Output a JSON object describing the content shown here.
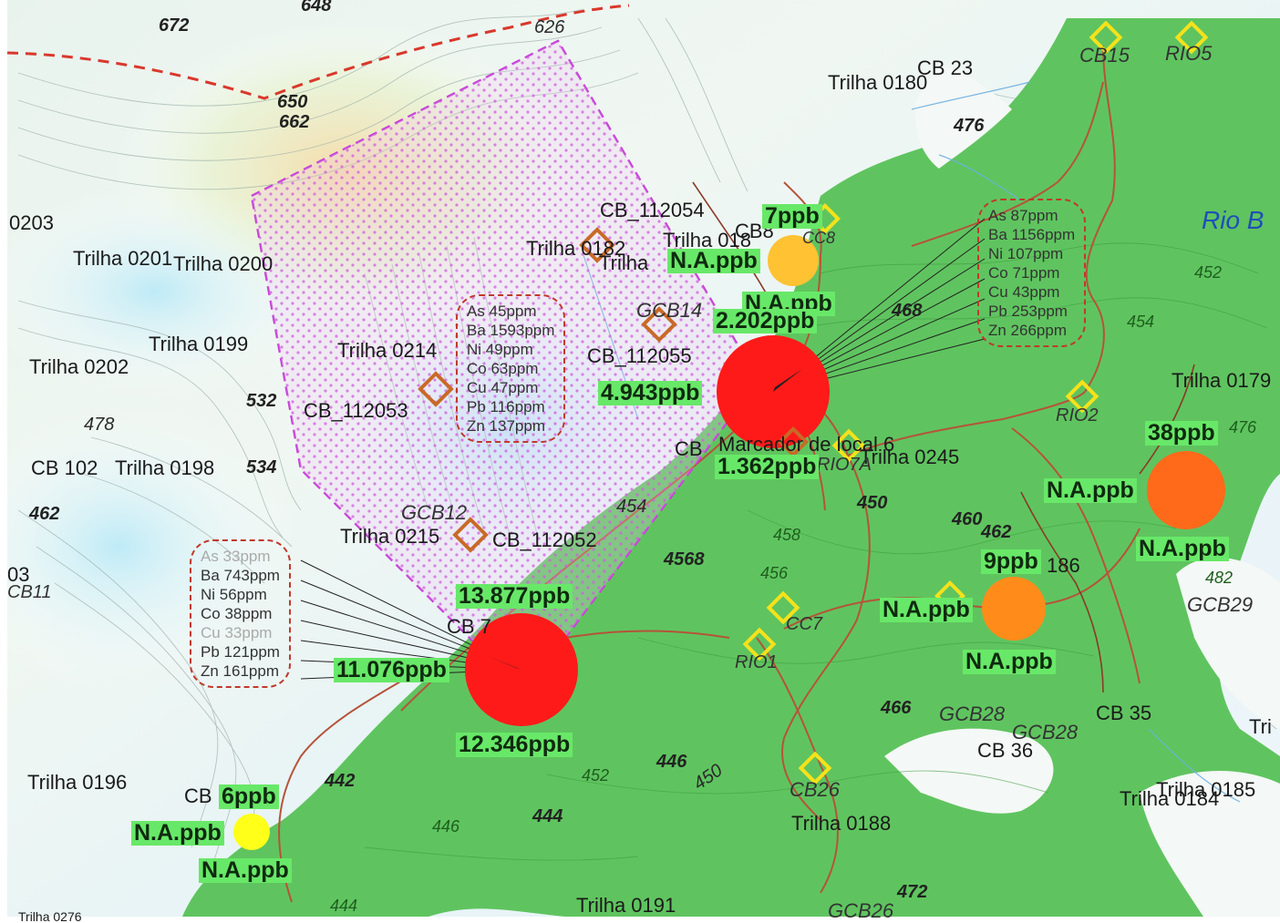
{
  "river": "Rio B",
  "trails": {
    "t0180": "Trilha 0180",
    "t0201": "Trilha 0201",
    "t0200": "Trilha 0200",
    "t0199": "Trilha 0199",
    "t0202": "Trilha 0202",
    "t0198": "Trilha 0198",
    "t0214": "Trilha 0214",
    "t0182": "Trilha 0182",
    "t018x": "Trilha 018",
    "t01b": "Trilha",
    "t0215": "Trilha 0215",
    "t0196": "Trilha 0196",
    "t0188": "Trilha 0188",
    "t0191": "Trilha 0191",
    "t0185": "Trilha 0185",
    "t0184": "Trilha 0184",
    "t0179": "Trilha 0179",
    "t0245": "Trilha 0245",
    "t0203": "0203",
    "t0276": "Trilha 0276"
  },
  "points": {
    "cb112054": "CB_112054",
    "cb112055": "CB_112055",
    "cb112053": "CB_112053",
    "cb112052": "CB_112052",
    "cb102": "CB 102",
    "cb23": "CB 23",
    "cb15": "CB15",
    "rio5": "RIO5",
    "cb8": "CB8",
    "cc8": "CC8",
    "gcb14": "GCB14",
    "gcb12": "GCB12",
    "rio2": "RIO2",
    "rio1": "RIO1",
    "cc7": "CC7",
    "rio7a": "RIO7A",
    "marcador": "Marcador de local 6",
    "cb_m": "CB",
    "cb186": "186",
    "cb35": "CB 35",
    "cb36": "CB 36",
    "cb26": "CB26",
    "gcb28a": "GCB28",
    "gcb28b": "GCB28",
    "gcb26": "GCB26",
    "gcb29": "GCB29",
    "cb11": "CB11",
    "cb6": "CB",
    "cb7": "CB 7",
    "n03": "03",
    "tri": "Tri"
  },
  "altitudes": [
    "626",
    "476",
    "478",
    "462",
    "454",
    "450",
    "458",
    "456",
    "4568",
    "466",
    "446",
    "452",
    "442",
    "444",
    "472",
    "460",
    "468",
    "454",
    "452",
    "482",
    "476",
    "450",
    "462",
    "534",
    "532",
    "650",
    "662",
    "648",
    "672",
    "444",
    "446"
  ],
  "ppb": {
    "p7": "7ppb",
    "na1": "N.A.ppb",
    "na2": "N.A.ppb",
    "p2202": "2.202ppb",
    "p4943": "4.943ppb",
    "p1362": "1.362ppb",
    "p38": "38ppb",
    "na3": "N.A.ppb",
    "na4": "N.A.ppb",
    "p13877": "13.877ppb",
    "p11076": "11.076ppb",
    "p12346": "12.346ppb",
    "p9": "9ppb",
    "na5": "N.A.ppb",
    "na6": "N.A.ppb",
    "p6": "6ppb",
    "na7": "N.A.ppb",
    "na8": "N.A.ppb"
  },
  "geochem": {
    "box1": [
      "As 45ppm",
      "Ba 1593ppm",
      "Ni 49ppm",
      "Co 63ppm",
      "Cu 47ppm",
      "Pb 116ppm",
      "Zn 137ppm"
    ],
    "box2": [
      "As 87ppm",
      "Ba 1156ppm",
      "Ni 107ppm",
      "Co 71ppm",
      "Cu 43ppm",
      "Pb 253ppm",
      "Zn 266ppm"
    ],
    "box3": [
      "As 33ppm",
      "Ba 743ppm",
      "Ni 56ppm",
      "Co 38ppm",
      "Cu 33ppm",
      "Pb 121ppm",
      "Zn 161ppm"
    ]
  },
  "colors": {
    "forest": "#5fc45f",
    "high": "#ff1a1a",
    "medium": "#ff7a1a",
    "low": "#ffc233",
    "lowest": "#ffff1a",
    "polygon": "#c43cd6"
  }
}
